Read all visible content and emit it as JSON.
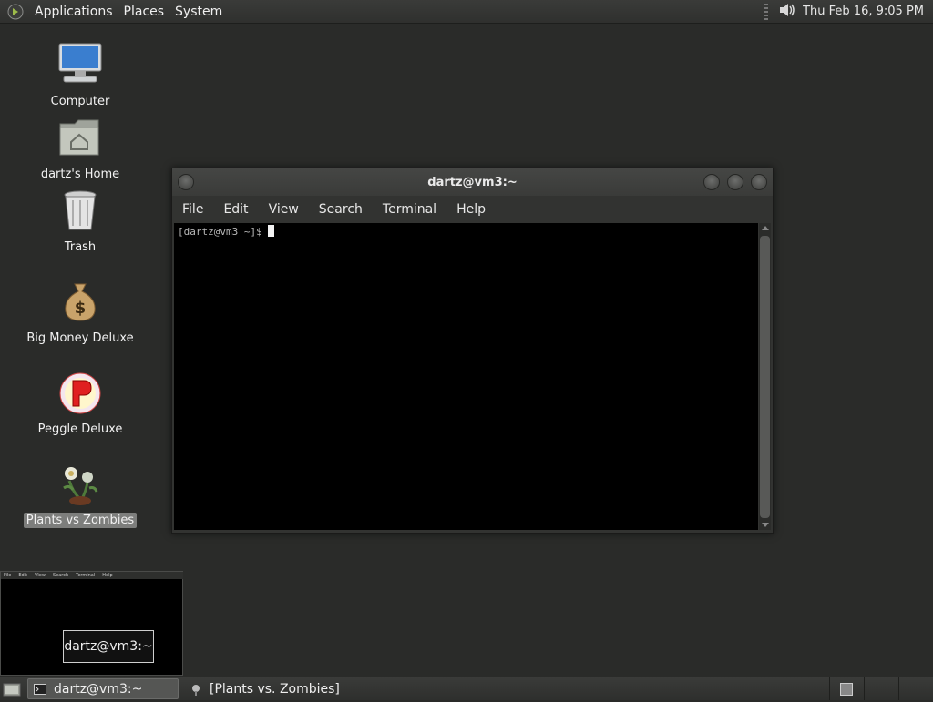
{
  "top_panel": {
    "menus": [
      "Applications",
      "Places",
      "System"
    ],
    "clock": "Thu Feb 16,  9:05 PM",
    "icons": [
      "gnome-foot-icon",
      "volume-icon"
    ]
  },
  "desktop_icons": [
    {
      "label": "Computer",
      "icon": "computer-icon"
    },
    {
      "label": "dartz's Home",
      "icon": "home-folder-icon"
    },
    {
      "label": "Trash",
      "icon": "trash-icon"
    },
    {
      "label": "Big Money Deluxe",
      "icon": "money-bag-icon"
    },
    {
      "label": "Peggle Deluxe",
      "icon": "peggle-icon"
    },
    {
      "label": "Plants vs Zombies",
      "icon": "plants-vs-zombies-icon",
      "selected": true
    }
  ],
  "terminal": {
    "title": "dartz@vm3:~",
    "menu": [
      "File",
      "Edit",
      "View",
      "Search",
      "Terminal",
      "Help"
    ],
    "prompt": "[dartz@vm3 ~]$"
  },
  "preview": {
    "tooltip": "dartz@vm3:~",
    "menu": [
      "File",
      "Edit",
      "View",
      "Search",
      "Terminal",
      "Help"
    ]
  },
  "taskbar": {
    "tasks": [
      {
        "label": "dartz@vm3:~",
        "icon": "terminal-icon",
        "active": true
      },
      {
        "label": "[Plants vs. Zombies]",
        "icon": "pvz-task-icon",
        "active": false
      }
    ],
    "workspaces": 3
  },
  "colors": {
    "desktop_bg": "#2a2b29",
    "panel_bg": "#353634",
    "terminal_bg": "#000000"
  }
}
